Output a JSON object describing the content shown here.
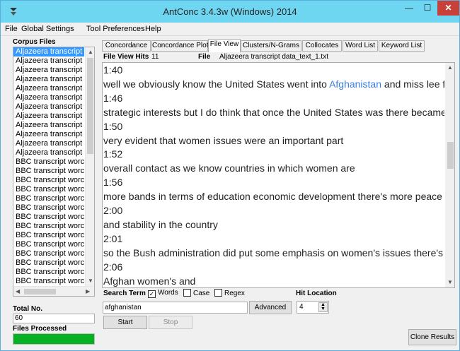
{
  "window": {
    "title": "AntConc 3.4.3w (Windows) 2014",
    "min_glyph": "—",
    "max_glyph": "☐",
    "close_glyph": "✕"
  },
  "menu": [
    "File",
    "Global Settings",
    "Tool Preferences",
    "Help"
  ],
  "left_panel": {
    "corpus_label": "Corpus Files",
    "files": [
      "Aljazeera transcript",
      "Aljazeera transcript",
      "Aljazeera transcript",
      "Aljazeera transcript",
      "Aljazeera transcript",
      "Aljazeera transcript",
      "Aljazeera transcript",
      "Aljazeera transcript",
      "Aljazeera transcript",
      "Aljazeera transcript",
      "Aljazeera transcript",
      "Aljazeera transcript",
      "BBC transcript worc",
      "BBC transcript worc",
      "BBC transcript worc",
      "BBC transcript worc",
      "BBC transcript worc",
      "BBC transcript worc",
      "BBC transcript worc",
      "BBC transcript worc",
      "BBC transcript worc",
      "BBC transcript worc",
      "BBC transcript worc",
      "BBC transcript worc",
      "BBC transcript worc",
      "BBC transcript worc"
    ],
    "total_label": "Total No.",
    "total_value": "60",
    "processed_label": "Files Processed",
    "processed_fraction": 1.0
  },
  "tabs": [
    {
      "label": "Concordance",
      "active": false
    },
    {
      "label": "Concordance Plot",
      "active": false
    },
    {
      "label": "File View",
      "active": true
    },
    {
      "label": "Clusters/N-Grams",
      "active": false
    },
    {
      "label": "Collocates",
      "active": false
    },
    {
      "label": "Word List",
      "active": false
    },
    {
      "label": "Keyword List",
      "active": false
    }
  ],
  "file_view": {
    "hits_label": "File View Hits",
    "hits": "11",
    "file_label": "File",
    "file_name": "Aljazeera transcript data_text_1.txt",
    "lines": [
      {
        "text": "1:40"
      },
      {
        "pre": "well we obviously know the United States went into ",
        "hit": "Afghanistan",
        "post": " and miss lee for"
      },
      {
        "text": "1:46"
      },
      {
        "text": "strategic interests but I do think that once the United States was there became"
      },
      {
        "text": "1:50"
      },
      {
        "text": "very evident that women issues were an important part"
      },
      {
        "text": "1:52"
      },
      {
        "text": "overall contact as we know countries in which women are"
      },
      {
        "text": "1:56"
      },
      {
        "text": "more bands in terms of education economic development there's more peace"
      },
      {
        "text": "2:00"
      },
      {
        "text": "and stability in the country"
      },
      {
        "text": "2:01"
      },
      {
        "text": "so the Bush administration did put some emphasis on women's issues there's a"
      },
      {
        "text": "2:06"
      },
      {
        "text": "Afghan women's and"
      }
    ],
    "highlight_color": "#3a7ddf"
  },
  "search": {
    "label": "Search Term",
    "words_label": "Words",
    "words_checked": true,
    "case_label": "Case",
    "case_checked": false,
    "regex_label": "Regex",
    "regex_checked": false,
    "term": "afghanistan",
    "advanced_label": "Advanced",
    "start_label": "Start",
    "stop_label": "Stop",
    "hit_location_label": "Hit Location",
    "hit_location_value": "4",
    "clone_label": "Clone Results"
  }
}
